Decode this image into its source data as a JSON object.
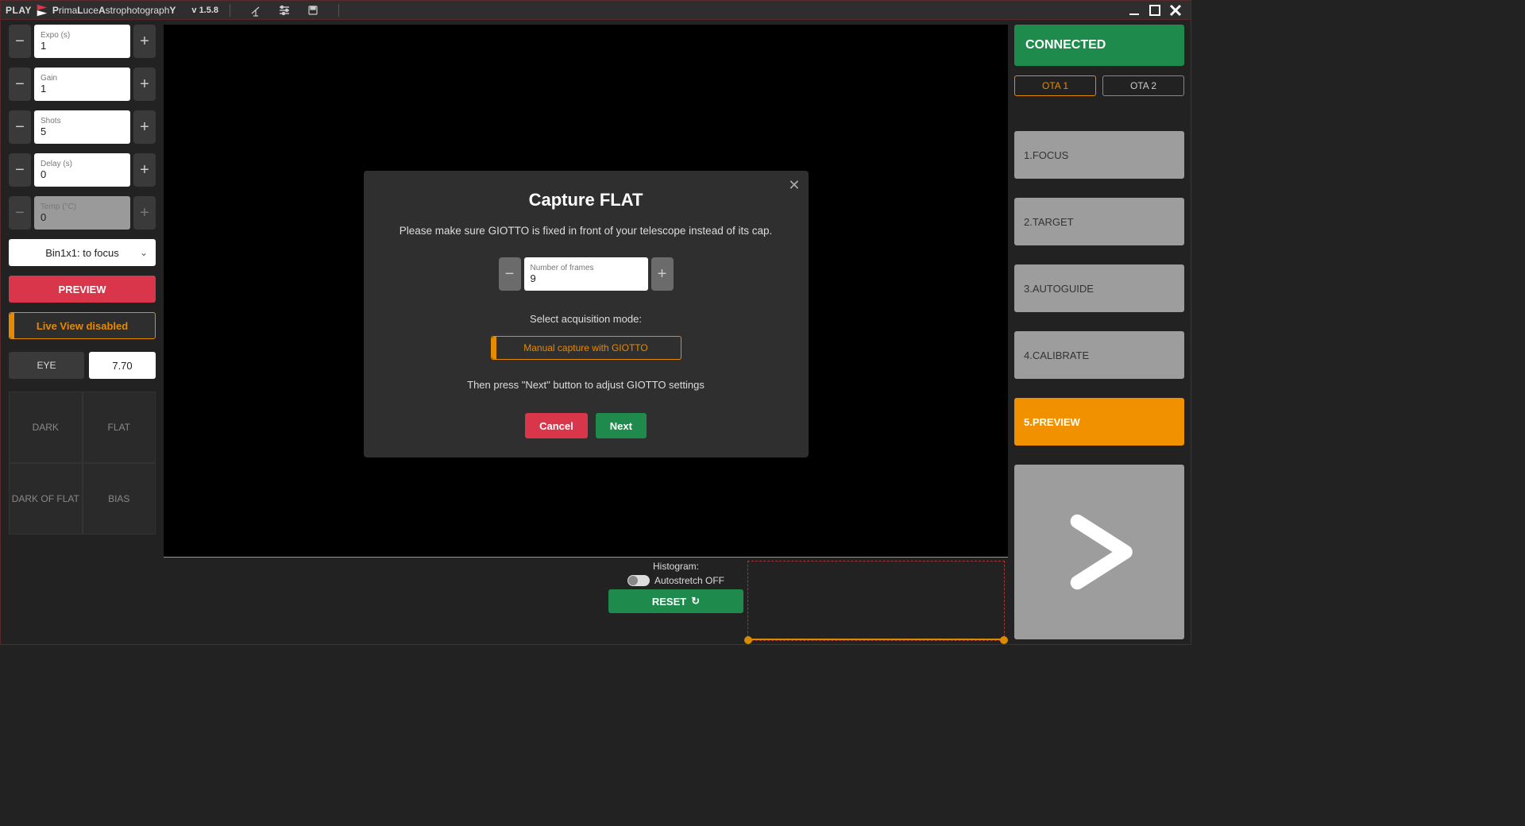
{
  "titlebar": {
    "play": "PLAY",
    "name_pre": "P",
    "name_mid1": "rima",
    "name_L": "L",
    "name_mid2": "uce",
    "name_A": "A",
    "name_mid3": "strophotograph",
    "name_Y": "Y",
    "version": "v 1.5.8"
  },
  "left": {
    "expo": {
      "label": "Expo (s)",
      "value": "1"
    },
    "gain": {
      "label": "Gain",
      "value": "1"
    },
    "shots": {
      "label": "Shots",
      "value": "5"
    },
    "delay": {
      "label": "Delay (s)",
      "value": "0"
    },
    "temp": {
      "label": "Temp (°C)",
      "value": "0"
    },
    "binning": "Bin1x1: to focus",
    "preview_btn": "PREVIEW",
    "liveview_btn": "Live View disabled",
    "eye_label": "EYE",
    "eye_value": "7.70",
    "calib": {
      "dark": "DARK",
      "flat": "FLAT",
      "darkflat": "DARK OF FLAT",
      "bias": "BIAS"
    }
  },
  "hist": {
    "label": "Histogram:",
    "autostretch": "Autostretch OFF",
    "reset": "RESET"
  },
  "right": {
    "connected": "CONNECTED",
    "ota1": "OTA 1",
    "ota2": "OTA 2",
    "steps": [
      "1.FOCUS",
      "2.TARGET",
      "3.AUTOGUIDE",
      "4.CALIBRATE",
      "5.PREVIEW"
    ]
  },
  "modal": {
    "title": "Capture FLAT",
    "msg": "Please make sure GIOTTO is fixed in front of your telescope instead of its cap.",
    "frames_label": "Number of frames",
    "frames_value": "9",
    "mode_label": "Select acquisition mode:",
    "mode_btn": "Manual capture with GIOTTO",
    "hint": "Then press \"Next\" button to adjust GIOTTO settings",
    "cancel": "Cancel",
    "next": "Next"
  }
}
